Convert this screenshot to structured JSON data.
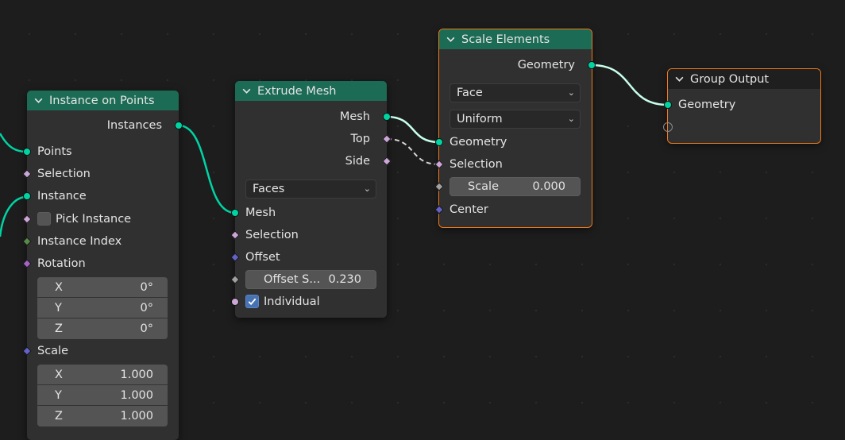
{
  "colors": {
    "canvas": "#1d1d1d",
    "node_body": "#303030",
    "geometry_header": "#1c6b55",
    "output_header": "#1f1f1f",
    "selection_outline": "#f07a18",
    "geometry_socket": "#00d4a3",
    "boolean_socket": "#cca6d6",
    "vector_socket": "#6363c7",
    "integer_socket": "#5a8a4a",
    "float_socket": "#a1a1a1",
    "rotation_socket": "#a663c7",
    "checkbox_on": "#4772b3"
  },
  "instance_on_points": {
    "title": "Instance on Points",
    "outputs": {
      "instances": "Instances"
    },
    "inputs": {
      "points": "Points",
      "selection": "Selection",
      "instance": "Instance",
      "pick_instance": {
        "label": "Pick Instance",
        "checked": false
      },
      "instance_index": "Instance Index",
      "rotation": "Rotation",
      "rotation_values": [
        {
          "axis": "X",
          "value": "0°"
        },
        {
          "axis": "Y",
          "value": "0°"
        },
        {
          "axis": "Z",
          "value": "0°"
        }
      ],
      "scale": "Scale",
      "scale_values": [
        {
          "axis": "X",
          "value": "1.000"
        },
        {
          "axis": "Y",
          "value": "1.000"
        },
        {
          "axis": "Z",
          "value": "1.000"
        }
      ]
    }
  },
  "extrude_mesh": {
    "title": "Extrude Mesh",
    "outputs": {
      "mesh": "Mesh",
      "top": "Top",
      "side": "Side"
    },
    "mode": "Faces",
    "inputs": {
      "mesh": "Mesh",
      "selection": "Selection",
      "offset": "Offset",
      "offset_scale": {
        "label": "Offset S...",
        "value": "0.230"
      },
      "individual": {
        "label": "Individual",
        "checked": true
      }
    }
  },
  "scale_elements": {
    "title": "Scale Elements",
    "outputs": {
      "geometry": "Geometry"
    },
    "domain": "Face",
    "scale_mode": "Uniform",
    "inputs": {
      "geometry": "Geometry",
      "selection": "Selection",
      "scale": {
        "label": "Scale",
        "value": "0.000"
      },
      "center": "Center"
    }
  },
  "group_output": {
    "title": "Group Output",
    "inputs": {
      "geometry": "Geometry"
    }
  },
  "icons": {
    "collapse": "chevron-down-icon",
    "dropdown": "dropdown-arrow-icon",
    "check": "checkmark-icon"
  }
}
